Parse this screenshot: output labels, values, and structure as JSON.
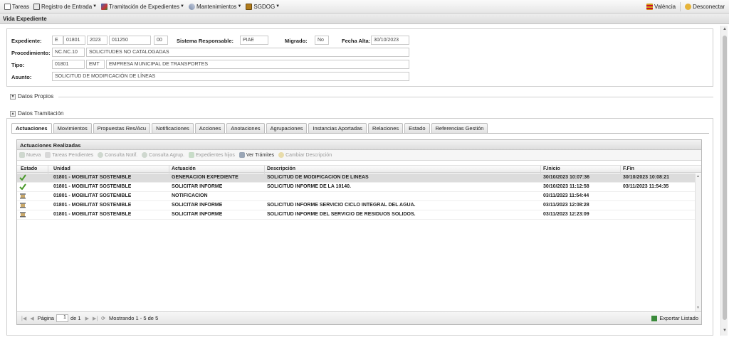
{
  "menubar": {
    "items": [
      {
        "label": "Tareas",
        "icon": "tasks-icon"
      },
      {
        "label": "Registro de Entrada",
        "icon": "register-icon"
      },
      {
        "label": "Tramitación de Expedientes",
        "icon": "files-icon"
      },
      {
        "label": "Mantenimientos",
        "icon": "wrench-icon"
      },
      {
        "label": "SGDOG",
        "icon": "db-icon"
      }
    ],
    "right": [
      {
        "label": "València",
        "icon": "flag-icon"
      },
      {
        "label": "Desconectar",
        "icon": "logout-icon"
      }
    ]
  },
  "title": "Vida Expediente",
  "header": {
    "expediente_label": "Expediente:",
    "exp_parts": [
      "E",
      "01801",
      "2023",
      "011250",
      "00"
    ],
    "sistema_label": "Sistema Responsable:",
    "sistema_value": "PIAE",
    "migrado_label": "Migrado:",
    "migrado_value": "No",
    "fecha_alta_label": "Fecha Alta:",
    "fecha_alta_value": "30/10/2023",
    "procedimiento_label": "Procedimiento:",
    "procedimiento_code": "NC.NC.10",
    "procedimiento_desc": "SOLICITUDES NO CATALOGADAS",
    "tipo_label": "Tipo:",
    "tipo_code": "01801",
    "tipo_abbr": "EMT",
    "tipo_desc": "EMPRESA MUNICIPAL DE TRANSPORTES",
    "asunto_label": "Asunto:",
    "asunto_value": "SOLICITUD DE MODIFICACIÓN DE LÍNEAS"
  },
  "sections": {
    "datos_propios": "Datos Propios",
    "datos_tramitacion": "Datos Tramitación"
  },
  "tabs": [
    "Actuaciones",
    "Movimientos",
    "Propuestas Res/Acu",
    "Notificaciones",
    "Acciones",
    "Anotaciones",
    "Agrupaciones",
    "Instancias Aportadas",
    "Relaciones",
    "Estado",
    "Referencias Gestión"
  ],
  "grid": {
    "title": "Actuaciones Realizadas",
    "toolbar": [
      {
        "label": "Nueva",
        "enabled": false
      },
      {
        "label": "Tareas Pendientes",
        "enabled": false
      },
      {
        "label": "Consulta Notif.",
        "enabled": false
      },
      {
        "label": "Consulta Agrup.",
        "enabled": false
      },
      {
        "label": "Expedientes hijos",
        "enabled": false
      },
      {
        "label": "Ver Trámites",
        "enabled": true
      },
      {
        "label": "Cambiar Descripción",
        "enabled": false
      }
    ],
    "columns": [
      "Estado",
      "Unidad",
      "Actuación",
      "Descripción",
      "F.Inicio",
      "F.Fin"
    ],
    "rows": [
      {
        "estado": "done",
        "unidad": "01801 - MOBILITAT SOSTENIBLE",
        "actuacion": "GENERACION EXPEDIENTE",
        "descripcion": "SOLICITUD DE MODIFICACIÓN DE LÍNEAS",
        "inicio": "30/10/2023 10:07:36",
        "fin": "30/10/2023 10:08:21"
      },
      {
        "estado": "done",
        "unidad": "01801 - MOBILITAT SOSTENIBLE",
        "actuacion": "SOLICITAR INFORME",
        "descripcion": "SOLICITUD INFORME DE LA 10140.",
        "inicio": "30/10/2023 11:12:58",
        "fin": "03/11/2023 11:54:35"
      },
      {
        "estado": "pending",
        "unidad": "01801 - MOBILITAT SOSTENIBLE",
        "actuacion": "NOTIFICACION",
        "descripcion": "",
        "inicio": "03/11/2023 11:54:44",
        "fin": ""
      },
      {
        "estado": "pending",
        "unidad": "01801 - MOBILITAT SOSTENIBLE",
        "actuacion": "SOLICITAR INFORME",
        "descripcion": "SOLICITUD INFORME SERVICIO CICLO INTEGRAL DEL AGUA.",
        "inicio": "03/11/2023 12:08:28",
        "fin": ""
      },
      {
        "estado": "pending",
        "unidad": "01801 - MOBILITAT SOSTENIBLE",
        "actuacion": "SOLICITAR INFORME",
        "descripcion": "SOLICITUD INFORME DEL SERVICIO DE RESIDUOS SÓLIDOS.",
        "inicio": "03/11/2023 12:23:09",
        "fin": ""
      }
    ],
    "pager": {
      "page_label": "Página",
      "page_value": "1",
      "of_label": "de 1",
      "showing": "Mostrando 1 - 5 de 5",
      "export_label": "Exportar Listado"
    }
  },
  "colors": {
    "check": "#4a9a2a",
    "selected_row": "#dcdcdc",
    "border": "#cfcfcf"
  }
}
